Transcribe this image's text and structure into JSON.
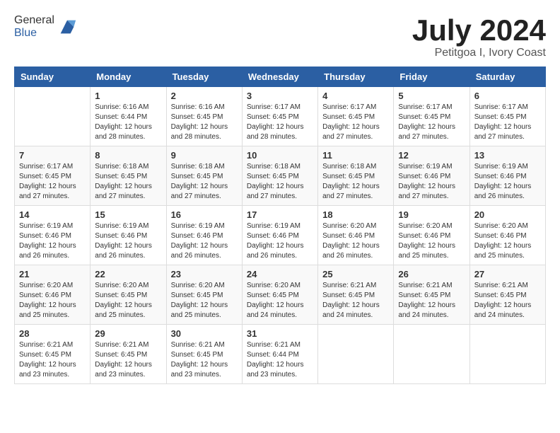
{
  "header": {
    "logo_general": "General",
    "logo_blue": "Blue",
    "month_title": "July 2024",
    "location": "Petitgoa I, Ivory Coast"
  },
  "columns": [
    "Sunday",
    "Monday",
    "Tuesday",
    "Wednesday",
    "Thursday",
    "Friday",
    "Saturday"
  ],
  "weeks": [
    [
      {
        "day": "",
        "info": ""
      },
      {
        "day": "1",
        "info": "Sunrise: 6:16 AM\nSunset: 6:44 PM\nDaylight: 12 hours\nand 28 minutes."
      },
      {
        "day": "2",
        "info": "Sunrise: 6:16 AM\nSunset: 6:45 PM\nDaylight: 12 hours\nand 28 minutes."
      },
      {
        "day": "3",
        "info": "Sunrise: 6:17 AM\nSunset: 6:45 PM\nDaylight: 12 hours\nand 28 minutes."
      },
      {
        "day": "4",
        "info": "Sunrise: 6:17 AM\nSunset: 6:45 PM\nDaylight: 12 hours\nand 27 minutes."
      },
      {
        "day": "5",
        "info": "Sunrise: 6:17 AM\nSunset: 6:45 PM\nDaylight: 12 hours\nand 27 minutes."
      },
      {
        "day": "6",
        "info": "Sunrise: 6:17 AM\nSunset: 6:45 PM\nDaylight: 12 hours\nand 27 minutes."
      }
    ],
    [
      {
        "day": "7",
        "info": "Sunrise: 6:17 AM\nSunset: 6:45 PM\nDaylight: 12 hours\nand 27 minutes."
      },
      {
        "day": "8",
        "info": "Sunrise: 6:18 AM\nSunset: 6:45 PM\nDaylight: 12 hours\nand 27 minutes."
      },
      {
        "day": "9",
        "info": "Sunrise: 6:18 AM\nSunset: 6:45 PM\nDaylight: 12 hours\nand 27 minutes."
      },
      {
        "day": "10",
        "info": "Sunrise: 6:18 AM\nSunset: 6:45 PM\nDaylight: 12 hours\nand 27 minutes."
      },
      {
        "day": "11",
        "info": "Sunrise: 6:18 AM\nSunset: 6:45 PM\nDaylight: 12 hours\nand 27 minutes."
      },
      {
        "day": "12",
        "info": "Sunrise: 6:19 AM\nSunset: 6:46 PM\nDaylight: 12 hours\nand 27 minutes."
      },
      {
        "day": "13",
        "info": "Sunrise: 6:19 AM\nSunset: 6:46 PM\nDaylight: 12 hours\nand 26 minutes."
      }
    ],
    [
      {
        "day": "14",
        "info": "Sunrise: 6:19 AM\nSunset: 6:46 PM\nDaylight: 12 hours\nand 26 minutes."
      },
      {
        "day": "15",
        "info": "Sunrise: 6:19 AM\nSunset: 6:46 PM\nDaylight: 12 hours\nand 26 minutes."
      },
      {
        "day": "16",
        "info": "Sunrise: 6:19 AM\nSunset: 6:46 PM\nDaylight: 12 hours\nand 26 minutes."
      },
      {
        "day": "17",
        "info": "Sunrise: 6:19 AM\nSunset: 6:46 PM\nDaylight: 12 hours\nand 26 minutes."
      },
      {
        "day": "18",
        "info": "Sunrise: 6:20 AM\nSunset: 6:46 PM\nDaylight: 12 hours\nand 26 minutes."
      },
      {
        "day": "19",
        "info": "Sunrise: 6:20 AM\nSunset: 6:46 PM\nDaylight: 12 hours\nand 25 minutes."
      },
      {
        "day": "20",
        "info": "Sunrise: 6:20 AM\nSunset: 6:46 PM\nDaylight: 12 hours\nand 25 minutes."
      }
    ],
    [
      {
        "day": "21",
        "info": "Sunrise: 6:20 AM\nSunset: 6:46 PM\nDaylight: 12 hours\nand 25 minutes."
      },
      {
        "day": "22",
        "info": "Sunrise: 6:20 AM\nSunset: 6:45 PM\nDaylight: 12 hours\nand 25 minutes."
      },
      {
        "day": "23",
        "info": "Sunrise: 6:20 AM\nSunset: 6:45 PM\nDaylight: 12 hours\nand 25 minutes."
      },
      {
        "day": "24",
        "info": "Sunrise: 6:20 AM\nSunset: 6:45 PM\nDaylight: 12 hours\nand 24 minutes."
      },
      {
        "day": "25",
        "info": "Sunrise: 6:21 AM\nSunset: 6:45 PM\nDaylight: 12 hours\nand 24 minutes."
      },
      {
        "day": "26",
        "info": "Sunrise: 6:21 AM\nSunset: 6:45 PM\nDaylight: 12 hours\nand 24 minutes."
      },
      {
        "day": "27",
        "info": "Sunrise: 6:21 AM\nSunset: 6:45 PM\nDaylight: 12 hours\nand 24 minutes."
      }
    ],
    [
      {
        "day": "28",
        "info": "Sunrise: 6:21 AM\nSunset: 6:45 PM\nDaylight: 12 hours\nand 23 minutes."
      },
      {
        "day": "29",
        "info": "Sunrise: 6:21 AM\nSunset: 6:45 PM\nDaylight: 12 hours\nand 23 minutes."
      },
      {
        "day": "30",
        "info": "Sunrise: 6:21 AM\nSunset: 6:45 PM\nDaylight: 12 hours\nand 23 minutes."
      },
      {
        "day": "31",
        "info": "Sunrise: 6:21 AM\nSunset: 6:44 PM\nDaylight: 12 hours\nand 23 minutes."
      },
      {
        "day": "",
        "info": ""
      },
      {
        "day": "",
        "info": ""
      },
      {
        "day": "",
        "info": ""
      }
    ]
  ]
}
